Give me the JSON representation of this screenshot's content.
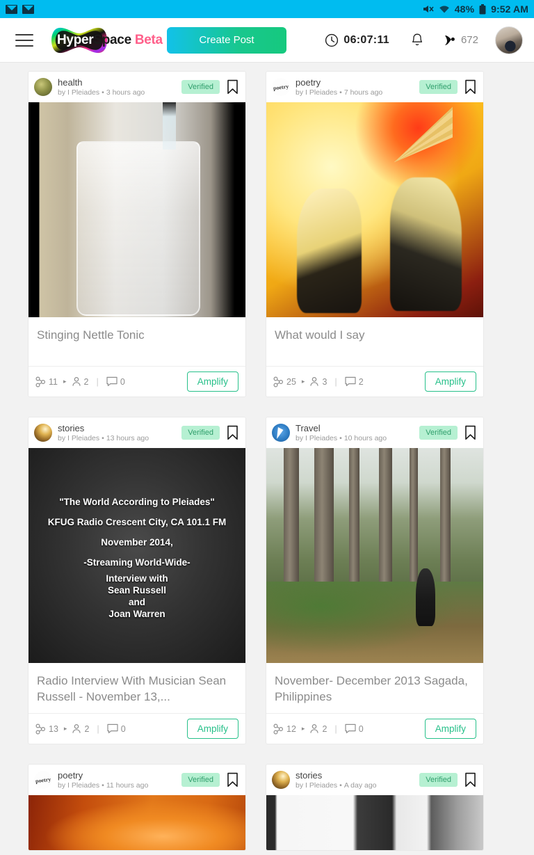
{
  "statusbar": {
    "icons": [
      "envelope-icon",
      "envelope-icon",
      "mute-icon",
      "wifi-icon",
      "battery-icon"
    ],
    "battery": "48%",
    "time": "9:52 AM"
  },
  "header": {
    "menu_icon": "hamburger-menu-icon",
    "logo": {
      "part1": "Hyper",
      "part2": "Space",
      "beta": "Beta"
    },
    "create_post_label": "Create Post",
    "clock": "06:07:11",
    "bell_icon": "bell-icon",
    "points": "672",
    "avatar": "user-avatar"
  },
  "feed": {
    "posts": [
      {
        "community": "health",
        "author": "by I Pleiades",
        "time": "3 hours ago",
        "badge": "Verified",
        "title": "Stinging Nettle Tonic",
        "shares": "11",
        "people": "2",
        "comments": "0",
        "amplify_label": "Amplify",
        "media": "m-jar",
        "avatar_class": "av-health"
      },
      {
        "community": "poetry",
        "author": "by I Pleiades",
        "time": "7 hours ago",
        "badge": "Verified",
        "title": "What would I say",
        "shares": "25",
        "people": "3",
        "comments": "2",
        "amplify_label": "Amplify",
        "media": "m-warm",
        "avatar_class": "av-poetry"
      },
      {
        "community": "stories",
        "author": "by I Pleiades",
        "time": "13 hours ago",
        "badge": "Verified",
        "title": "Radio Interview With Musician Sean Russell - November 13,...",
        "shares": "13",
        "people": "2",
        "comments": "0",
        "amplify_label": "Amplify",
        "media": "m-radio",
        "avatar_class": "av-stories",
        "poster_lines": [
          "\"The World According to Pleiades\"",
          "KFUG Radio Crescent City, CA 101.1 FM",
          "November  2014,",
          "-Streaming World-Wide-",
          "Interview with",
          "Sean Russell",
          "and",
          "Joan Warren"
        ]
      },
      {
        "community": "Travel",
        "author": "by I Pleiades",
        "time": "10 hours ago",
        "badge": "Verified",
        "title": "November- December 2013 Sagada, Philippines",
        "shares": "12",
        "people": "2",
        "comments": "0",
        "amplify_label": "Amplify",
        "media": "m-forest",
        "avatar_class": "av-travel"
      },
      {
        "community": "poetry",
        "author": "by I Pleiades",
        "time": "11 hours ago",
        "badge": "Verified",
        "media": "m-orange",
        "avatar_class": "av-poetry"
      },
      {
        "community": "stories",
        "author": "by I Pleiades",
        "time": "A day ago",
        "badge": "Verified",
        "media": "m-bw",
        "avatar_class": "av-stories"
      }
    ]
  },
  "colors": {
    "statusbar": "#00bcf0",
    "accent_green": "#27c08a",
    "badge_bg": "#b6f0d2",
    "badge_fg": "#2f9e6b",
    "beta_pink": "#ff5f8a"
  }
}
